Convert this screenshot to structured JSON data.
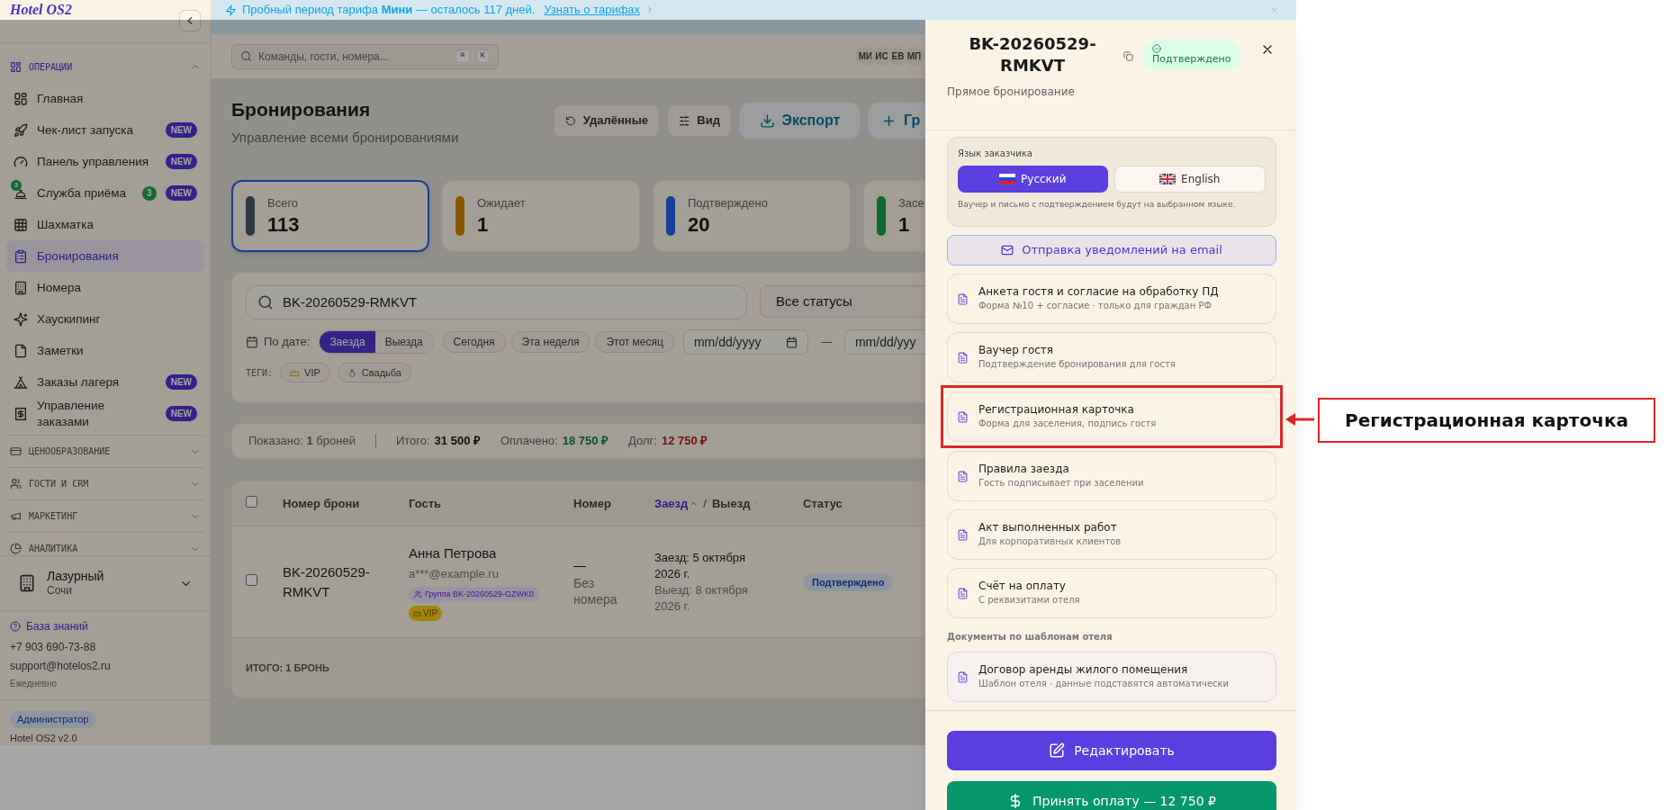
{
  "sidebar": {
    "logo": "Hotel OS2",
    "sections": [
      {
        "title": "ОПЕРАЦИИ",
        "expanded": true,
        "items": [
          {
            "label": "Главная",
            "selected": false
          },
          {
            "label": "Чек-лист запуска",
            "badge": "NEW",
            "selected": false
          },
          {
            "label": "Панель управления",
            "badge": "NEW",
            "selected": false
          },
          {
            "label": "Служба приёма",
            "icon_badge": "3",
            "count": "3",
            "badge": "NEW",
            "selected": false
          },
          {
            "label": "Шахматка",
            "selected": false
          },
          {
            "label": "Бронирования",
            "selected": true
          },
          {
            "label": "Номера",
            "selected": false
          },
          {
            "label": "Хаускипинг",
            "selected": false
          },
          {
            "label": "Заметки",
            "selected": false
          },
          {
            "label": "Заказы лагеря",
            "badge": "NEW",
            "selected": false
          },
          {
            "label": "Управление заказами",
            "badge": "NEW",
            "selected": false
          }
        ]
      },
      {
        "title": "ЦЕНООБРАЗОВАНИЕ",
        "expanded": false
      },
      {
        "title": "ГОСТИ И CRM",
        "expanded": false
      },
      {
        "title": "МАРКЕТИНГ",
        "expanded": false
      },
      {
        "title": "АНАЛИТИКА",
        "expanded": false
      }
    ],
    "hotel": {
      "name": "Лазурный",
      "city": "Сочи"
    },
    "help": {
      "link": "База знаний",
      "phone": "+7 903 690-73-88",
      "email": "support@hotelos2.ru",
      "hours": "Ежедневно"
    },
    "role": "Администратор",
    "version": "Hotel OS2 v2.0"
  },
  "banner": {
    "text": "Пробный период тарифа **Мини** — осталось 117 дней.",
    "link": "Узнать о тарифах"
  },
  "header": {
    "search_placeholder": "Команды, гости, номера...",
    "shortcut": [
      "⌘",
      "K"
    ],
    "avatars": [
      "МИ",
      "ИС",
      "ЕВ",
      "МП"
    ]
  },
  "page": {
    "title": "Бронирования",
    "subtitle": "Управление всеми бронированиями",
    "actions": [
      {
        "label": "Удалённые",
        "kind": "secondary"
      },
      {
        "label": "Вид",
        "kind": "secondary"
      },
      {
        "label": "Экспорт",
        "kind": "accent"
      },
      {
        "label": "Гр",
        "kind": "accent"
      }
    ]
  },
  "stats": [
    {
      "label": "Всего",
      "value": "113",
      "kind": "all",
      "selected": true
    },
    {
      "label": "Ожидает",
      "value": "1",
      "kind": "pending",
      "selected": false
    },
    {
      "label": "Подтверждено",
      "value": "20",
      "kind": "confirmed",
      "selected": false
    },
    {
      "label": "Засе",
      "value": "1",
      "kind": "checked_in",
      "selected": false
    }
  ],
  "filters": {
    "search_value": "BK-20260529-RMKVT",
    "status": "Все статусы",
    "date_label": "По дате:",
    "date_modes": [
      {
        "label": "Заезда",
        "selected": true
      },
      {
        "label": "Выезда",
        "selected": false
      }
    ],
    "quick_ranges": [
      "Сегодня",
      "Эта неделя",
      "Этот месяц"
    ],
    "date_from": "mm/dd/yyyy",
    "date_separator": "—",
    "date_to": "mm/dd/yyy",
    "tags_label": "ТЕГИ:",
    "tags": [
      "VIP",
      "Свадьба"
    ]
  },
  "summary": {
    "shown": "Показано: **1** броней",
    "totals": [
      {
        "label": "Итого:",
        "value": "31 500 ₽",
        "kind": "total"
      },
      {
        "label": "Оплачено:",
        "value": "18 750 ₽",
        "kind": "paid"
      },
      {
        "label": "Долг:",
        "value": "12 750 ₽",
        "kind": "debt"
      }
    ]
  },
  "table": {
    "all_checked": false,
    "columns": [
      {
        "label": "Номер брони"
      },
      {
        "label": "Гость"
      },
      {
        "label": "Номер"
      },
      {
        "label": "Заезд",
        "sorted": true
      },
      {
        "label": "Выезд",
        "sorted": false
      },
      {
        "label": "Статус"
      }
    ],
    "sort_separator": "/",
    "rows": [
      {
        "checked": false,
        "booking": "BK-20260529-RMKVT",
        "guest": "Анна Петрова",
        "email": "a***@example.ru",
        "group": "Группа BK-20260529-GZWK0",
        "tags": [
          "VIP"
        ],
        "room": "—",
        "room_note": "Без номера",
        "checkin": "Заезд: 5 октября 2026 г.",
        "checkout": "Выезд: 8 октября 2026 г.",
        "status": "Подтверждено"
      }
    ],
    "footer": "ИТОГО: 1 БРОНЬ"
  },
  "drawer": {
    "title": "BK-20260529-RMKVT",
    "status": "Подтверждено",
    "source": "Прямое бронирование",
    "language": {
      "label": "Язык заказчика",
      "options": [
        {
          "label": "Русский",
          "selected": true
        },
        {
          "label": "English",
          "selected": false
        }
      ],
      "note": "Ваучер и письмо с подтверждением будут на выбранном языке."
    },
    "email_button": "Отправка уведомлений на email",
    "documents": [
      {
        "title": "Анкета гостя и согласие на обработку ПД",
        "subtitle": "Форма №10 + согласие · только для граждан РФ",
        "highlighted": false
      },
      {
        "title": "Ваучер гостя",
        "subtitle": "Подтверждение бронирования для гостя",
        "highlighted": false
      },
      {
        "title": "Регистрационная карточка",
        "subtitle": "Форма для заселения, подпись гостя",
        "highlighted": true
      },
      {
        "title": "Правила заезда",
        "subtitle": "Гость подписывает при заселении",
        "highlighted": false
      },
      {
        "title": "Акт выполненных работ",
        "subtitle": "Для корпоративных клиентов",
        "highlighted": false
      },
      {
        "title": "Счёт на оплату",
        "subtitle": "С реквизитами отеля",
        "highlighted": false
      }
    ],
    "templates_label": "Документы по шаблонам отеля",
    "templates": [
      {
        "title": "Договор аренды жилого помещения",
        "subtitle": "Шаблон отеля · данные подставятся автоматически"
      }
    ],
    "actions": [
      {
        "label": "Редактировать",
        "kind": "primary"
      },
      {
        "label": "Принять оплату — 12 750 ₽",
        "kind": "success"
      }
    ]
  },
  "callout": {
    "label": "Регистрационная карточка"
  }
}
